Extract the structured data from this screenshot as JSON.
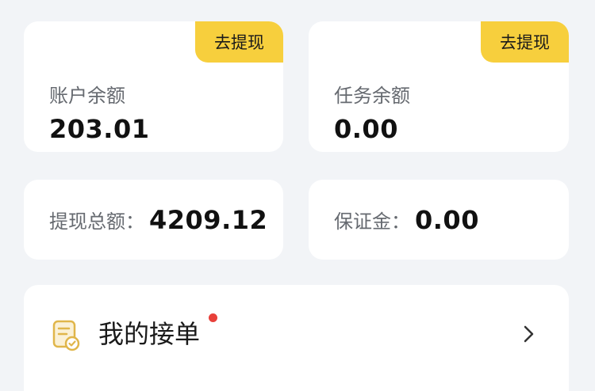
{
  "account_card": {
    "badge": "去提现",
    "label": "账户余额",
    "amount": "203.01"
  },
  "task_card": {
    "badge": "去提现",
    "label": "任务余额",
    "amount": "0.00"
  },
  "withdraw_total_card": {
    "label": "提现总额：",
    "amount": "4209.12"
  },
  "deposit_card": {
    "label": "保证金：",
    "amount": "0.00"
  },
  "orders_row": {
    "title": "我的接单",
    "icon": "order-list-icon",
    "has_notification_dot": true,
    "chevron_icon": "chevron-right-icon"
  },
  "colors": {
    "background": "#f2f4f7",
    "badge": "#f7cf3d",
    "notification_dot": "#e8403a",
    "icon_accent": "#e0b64a"
  }
}
